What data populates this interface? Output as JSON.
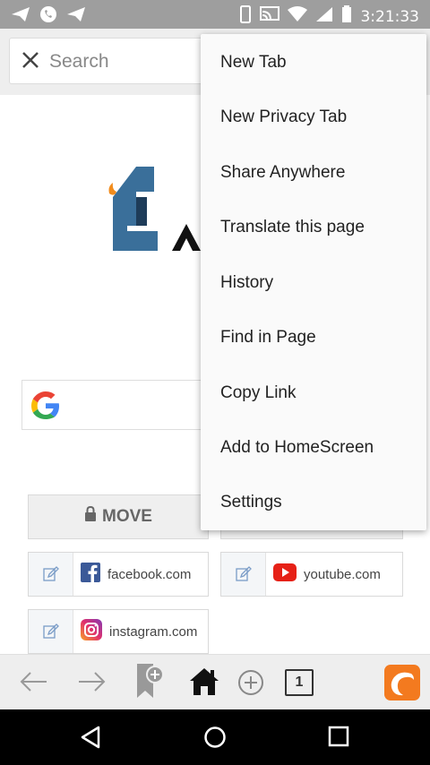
{
  "status_bar": {
    "time": "3:21:33",
    "icons": [
      "telegram-icon",
      "whatsapp-icon",
      "send-icon",
      "vibrate-icon",
      "cast-icon",
      "wifi-icon",
      "signal-icon",
      "battery-icon"
    ]
  },
  "search": {
    "placeholder": "Search"
  },
  "content": {
    "move_label": "MOVE",
    "shortcuts": [
      {
        "label": "facebook.com",
        "icon": "facebook-icon"
      },
      {
        "label": "youtube.com",
        "icon": "youtube-icon"
      },
      {
        "label": "instagram.com",
        "icon": "instagram-icon"
      }
    ]
  },
  "menu": {
    "items": [
      "New Tab",
      "New Privacy Tab",
      "Share Anywhere",
      "Translate this page",
      "History",
      "Find in Page",
      "Copy Link",
      "Add to HomeScreen",
      "Settings"
    ]
  },
  "bottom_bar": {
    "tab_count": "1"
  },
  "colors": {
    "status_bar": "#9e9e9e",
    "brand_orange": "#f37a1f",
    "facebook_blue": "#3b5998",
    "youtube_red": "#e62117"
  }
}
